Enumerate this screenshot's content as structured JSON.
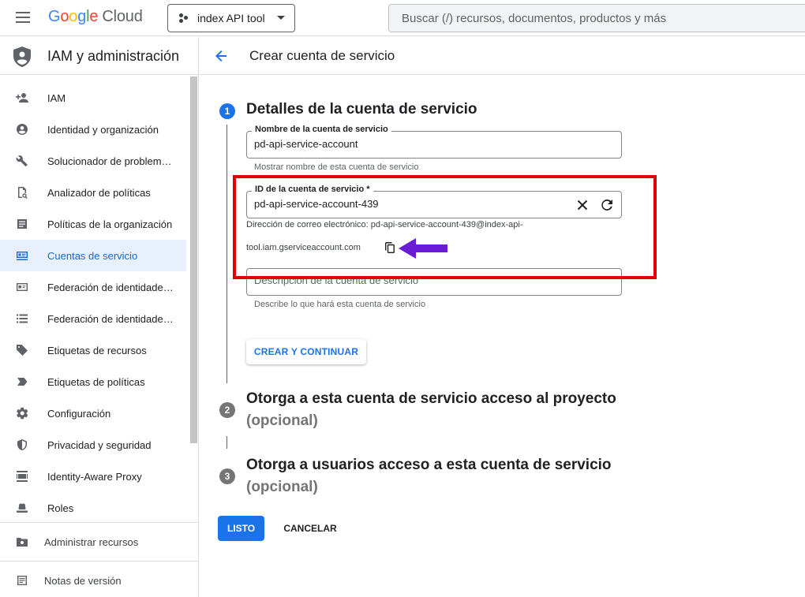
{
  "header": {
    "logo_google": "Google",
    "logo_cloud": "Cloud",
    "project_name": "index API tool",
    "search_placeholder": "Buscar (/) recursos, documentos, productos y más"
  },
  "sidebar": {
    "title": "IAM y administración",
    "items": [
      {
        "label": "IAM",
        "icon": "person-add-icon"
      },
      {
        "label": "Identidad y organización",
        "icon": "account-circle-icon"
      },
      {
        "label": "Solucionador de problem…",
        "icon": "wrench-icon"
      },
      {
        "label": "Analizador de políticas",
        "icon": "document-search-icon"
      },
      {
        "label": "Políticas de la organización",
        "icon": "article-icon"
      },
      {
        "label": "Cuentas de servicio",
        "icon": "service-account-icon",
        "active": true
      },
      {
        "label": "Federación de identidade…",
        "icon": "id-card-icon"
      },
      {
        "label": "Federación de identidade…",
        "icon": "list-icon"
      },
      {
        "label": "Etiquetas de recursos",
        "icon": "tag-icon"
      },
      {
        "label": "Etiquetas de políticas",
        "icon": "label-icon"
      },
      {
        "label": "Configuración",
        "icon": "gear-icon"
      },
      {
        "label": "Privacidad y seguridad",
        "icon": "shield-icon"
      },
      {
        "label": "Identity-Aware Proxy",
        "icon": "proxy-icon"
      },
      {
        "label": "Roles",
        "icon": "hat-icon"
      }
    ],
    "footer_manage": "Administrar recursos",
    "footer_notes": "Notas de versión"
  },
  "main": {
    "title": "Crear cuenta de servicio",
    "step1": {
      "number": "1",
      "title": "Detalles de la cuenta de servicio",
      "name_label": "Nombre de la cuenta de servicio",
      "name_value": "pd-api-service-account",
      "name_hint": "Mostrar nombre de esta cuenta de servicio",
      "id_label": "ID de la cuenta de servicio *",
      "id_value": "pd-api-service-account-439",
      "email_line1": "Dirección de correo electrónico: pd-api-service-account-439@index-api-",
      "email_line2": "tool.iam.gserviceaccount.com",
      "desc_placeholder": "Descripción de la cuenta de servicio",
      "desc_hint": "Describe lo que hará esta cuenta de servicio",
      "continue_button": "CREAR Y CONTINUAR"
    },
    "step2": {
      "number": "2",
      "title": "Otorga a esta cuenta de servicio acceso al proyecto",
      "optional": "(opcional)"
    },
    "step3": {
      "number": "3",
      "title": "Otorga a usuarios acceso a esta cuenta de servicio",
      "optional": "(opcional)"
    },
    "done_button": "LISTO",
    "cancel_button": "CANCELAR"
  },
  "colors": {
    "accent": "#1a73e8",
    "highlight_box": "#e00000",
    "arrow": "#6a1bd6"
  }
}
